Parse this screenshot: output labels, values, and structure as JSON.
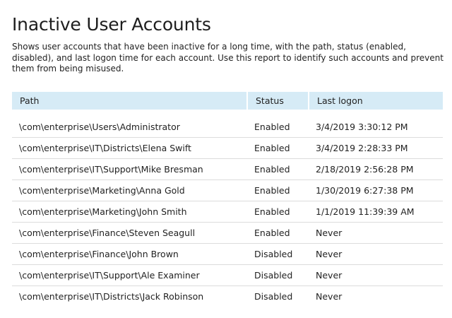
{
  "report": {
    "title": "Inactive User Accounts",
    "description": "Shows user accounts that have been inactive for a long time, with the path, status (enabled, disabled), and last logon time for each account. Use this report to identify such accounts and prevent them from being misused."
  },
  "table": {
    "columns": [
      "Path",
      "Status",
      "Last logon"
    ],
    "rows": [
      {
        "path": "\\com\\enterprise\\Users\\Administrator",
        "status": "Enabled",
        "last_logon": "3/4/2019 3:30:12 PM"
      },
      {
        "path": "\\com\\enterprise\\IT\\Districts\\Elena Swift",
        "status": "Enabled",
        "last_logon": "3/4/2019 2:28:33 PM"
      },
      {
        "path": "\\com\\enterprise\\IT\\Support\\Mike Bresman",
        "status": "Enabled",
        "last_logon": "2/18/2019 2:56:28 PM"
      },
      {
        "path": "\\com\\enterprise\\Marketing\\Anna Gold",
        "status": "Enabled",
        "last_logon": "1/30/2019 6:27:38 PM"
      },
      {
        "path": "\\com\\enterprise\\Marketing\\John Smith",
        "status": "Enabled",
        "last_logon": "1/1/2019 11:39:39 AM"
      },
      {
        "path": "\\com\\enterprise\\Finance\\Steven Seagull",
        "status": "Enabled",
        "last_logon": "Never"
      },
      {
        "path": "\\com\\enterprise\\Finance\\John Brown",
        "status": "Disabled",
        "last_logon": "Never"
      },
      {
        "path": "\\com\\enterprise\\IT\\Support\\Ale Examiner",
        "status": "Disabled",
        "last_logon": "Never"
      },
      {
        "path": "\\com\\enterprise\\IT\\Districts\\Jack Robinson",
        "status": "Disabled",
        "last_logon": "Never"
      }
    ]
  },
  "colors": {
    "header_background": "#d6ebf6",
    "row_divider": "#dcdcdc",
    "text": "#222222"
  }
}
